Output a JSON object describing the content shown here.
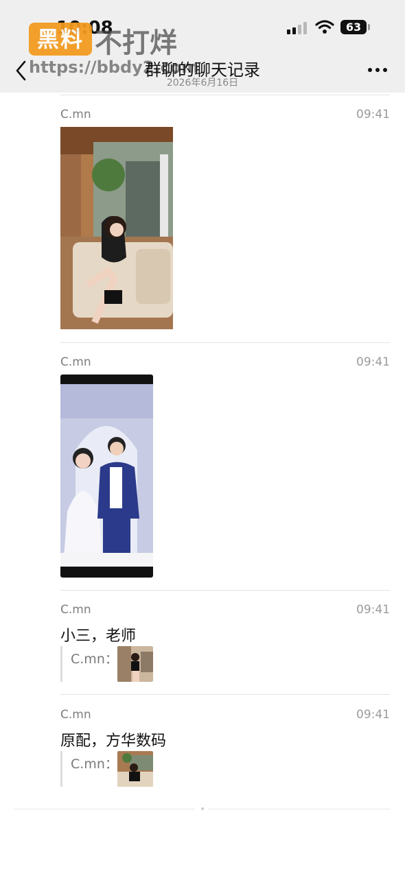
{
  "status_bar": {
    "time": "10:08",
    "battery": "63"
  },
  "watermark": {
    "badge": "黑料",
    "text": "不打烊",
    "url": "https://bbdy2.com"
  },
  "header": {
    "title": "群聊的聊天记录",
    "subtitle": "2026年6月16日"
  },
  "messages": [
    {
      "sender": "C.mn",
      "time": "09:41",
      "type": "image",
      "image": "woman-sitting-on-sofa-photo"
    },
    {
      "sender": "C.mn",
      "time": "09:41",
      "type": "image",
      "image": "wedding-couple-screenshot"
    },
    {
      "sender": "C.mn",
      "time": "09:41",
      "type": "text",
      "text": "小三，老师",
      "quote_sender": "C.mn：",
      "quote_image": "woman-sitting-thumbnail"
    },
    {
      "sender": "C.mn",
      "time": "09:41",
      "type": "text",
      "text": "原配，方华数码",
      "quote_sender": "C.mn：",
      "quote_image": "woman-sofa-thumbnail"
    }
  ],
  "colors": {
    "header_bg": "#efefef",
    "watermark_badge": "#f39a1d"
  }
}
